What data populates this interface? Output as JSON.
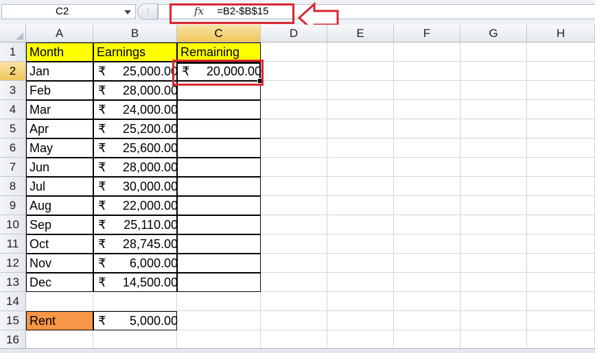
{
  "namebox": {
    "value": "C2"
  },
  "formula_bar": {
    "fx_label": "fx",
    "formula": "=B2-$B$15"
  },
  "columns": [
    "A",
    "B",
    "C",
    "D",
    "E",
    "F",
    "G",
    "H"
  ],
  "rows": [
    "1",
    "2",
    "3",
    "4",
    "5",
    "6",
    "7",
    "8",
    "9",
    "10",
    "11",
    "12",
    "13",
    "14",
    "15",
    "16"
  ],
  "headers": {
    "month": "Month",
    "earnings": "Earnings",
    "remaining": "Remaining"
  },
  "currency_symbol": "₹",
  "data_rows": [
    {
      "month": "Jan",
      "earnings": "25,000.00",
      "remaining": "20,000.00"
    },
    {
      "month": "Feb",
      "earnings": "28,000.00",
      "remaining": ""
    },
    {
      "month": "Mar",
      "earnings": "24,000.00",
      "remaining": ""
    },
    {
      "month": "Apr",
      "earnings": "25,200.00",
      "remaining": ""
    },
    {
      "month": "May",
      "earnings": "25,600.00",
      "remaining": ""
    },
    {
      "month": "Jun",
      "earnings": "28,000.00",
      "remaining": ""
    },
    {
      "month": "Jul",
      "earnings": "30,000.00",
      "remaining": ""
    },
    {
      "month": "Aug",
      "earnings": "22,000.00",
      "remaining": ""
    },
    {
      "month": "Sep",
      "earnings": "25,110.00",
      "remaining": ""
    },
    {
      "month": "Oct",
      "earnings": "28,745.00",
      "remaining": ""
    },
    {
      "month": "Nov",
      "earnings": "6,000.00",
      "remaining": ""
    },
    {
      "month": "Dec",
      "earnings": "14,500.00",
      "remaining": ""
    }
  ],
  "rent_row": {
    "label": "Rent",
    "amount": "5,000.00"
  },
  "colors": {
    "header_fill": "#ffff00",
    "rent_fill": "#f79646",
    "highlight": "#d8262f",
    "active_header": "#f1c75a"
  }
}
